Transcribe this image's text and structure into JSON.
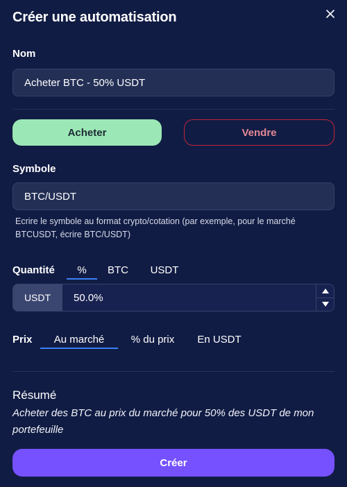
{
  "modal": {
    "title": "Créer une automatisation",
    "close_icon": "close-icon"
  },
  "name_field": {
    "label": "Nom",
    "value": "Acheter BTC - 50% USDT"
  },
  "side": {
    "buy_label": "Acheter",
    "sell_label": "Vendre",
    "selected": "Acheter",
    "buy_color": "#9be7b5",
    "sell_color": "#c0243b"
  },
  "symbol_field": {
    "label": "Symbole",
    "value": "BTC/USDT",
    "helper": "Ecrire le symbole au format crypto/cotation (par exemple, pour le marché BTCUSDT, écrire BTC/USDT)"
  },
  "quantity": {
    "label": "Quantité",
    "tabs": [
      "%",
      "BTC",
      "USDT"
    ],
    "selected_tab": "%",
    "prefix": "USDT",
    "value": "50.0%"
  },
  "price": {
    "label": "Prix",
    "tabs": [
      "Au marché",
      "% du prix",
      "En USDT"
    ],
    "selected_tab": "Au marché"
  },
  "summary": {
    "title": "Résumé",
    "text": "Acheter des BTC au prix du marché pour 50% des USDT de mon portefeuille"
  },
  "actions": {
    "create_label": "Créer",
    "create_color": "#7551ff"
  },
  "colors": {
    "background": "#111c44",
    "accent": "#3b82f6"
  }
}
